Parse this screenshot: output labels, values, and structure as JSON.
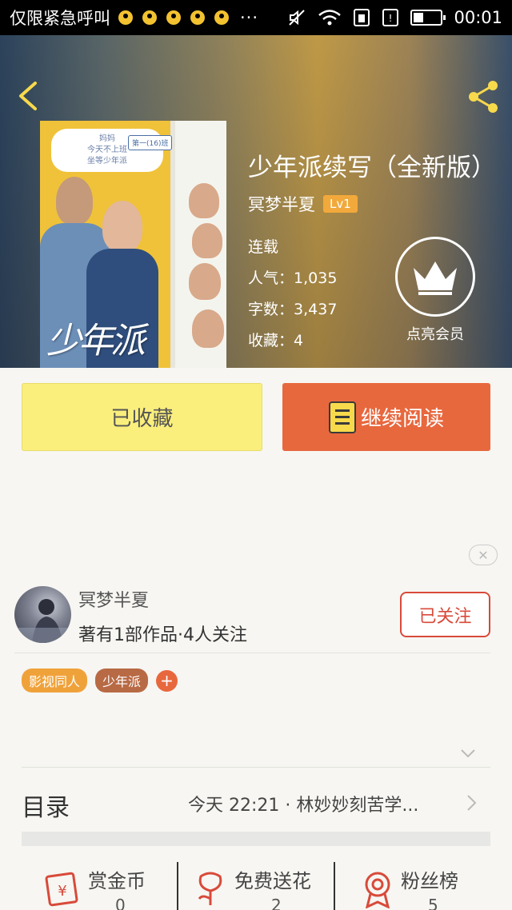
{
  "status_bar": {
    "carrier": "仅限紧急呼叫",
    "more": "···",
    "time": "00:01"
  },
  "book": {
    "title": "少年派续写（全新版）",
    "author": "冥梦半夏",
    "level": "Lv1",
    "status": "连载",
    "popularity_label": "人气：",
    "popularity": "1,035",
    "wordcount_label": "字数：",
    "wordcount": "3,437",
    "favorites_label": "收藏：",
    "favorites": "4",
    "cover": {
      "sticker_text_1": "妈妈",
      "sticker_text_2": "今天不上班",
      "sticker_text_3": "坐等少年派",
      "tag_text": "第一(16)班",
      "title_text": "少年派"
    }
  },
  "member": {
    "label": "点亮会员"
  },
  "actions": {
    "favorited_label": "已收藏",
    "continue_label": "继续阅读"
  },
  "ad": {
    "close_symbol": "✕"
  },
  "author_card": {
    "name": "冥梦半夏",
    "subtitle": "著有1部作品·4人关注",
    "follow_label": "已关注"
  },
  "tags": [
    "影视同人",
    "少年派"
  ],
  "tag_add_symbol": "+",
  "toc": {
    "label": "目录",
    "latest": "今天 22:21 · 林妙妙刻苦学..."
  },
  "bottom": [
    {
      "label": "赏金币",
      "value": "0"
    },
    {
      "label": "免费送花",
      "value": "2"
    },
    {
      "label": "粉丝榜",
      "value": "5"
    }
  ],
  "colors": {
    "accent_orange": "#e8683e",
    "fav_yellow": "#faef7d",
    "follow_red": "#d84a3a",
    "tag_orange": "#f0a23a",
    "tag_brown": "#b86a45"
  }
}
